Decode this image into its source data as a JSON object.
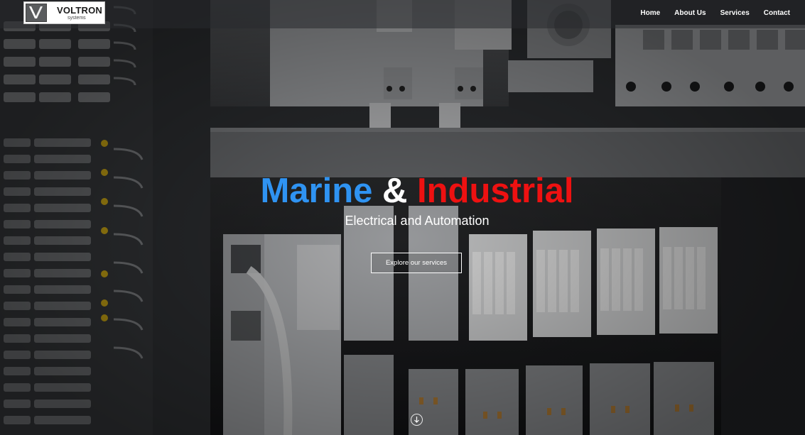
{
  "brand": {
    "name": "VOLTRON",
    "tagline": "systems"
  },
  "nav": {
    "items": [
      {
        "label": "Home"
      },
      {
        "label": "About Us"
      },
      {
        "label": "Services"
      },
      {
        "label": "Contact"
      }
    ]
  },
  "hero": {
    "title_part1": "Marine",
    "title_part2": "&",
    "title_part3": "Industrial",
    "subtitle": "Electrical and Automation",
    "cta_label": "Explore our services"
  },
  "colors": {
    "title_blue": "#2f93f2",
    "title_red": "#ee1111",
    "text_white": "#ffffff"
  },
  "icons": {
    "logo_mark": "v-logo-icon",
    "scroll": "arrow-down-icon"
  }
}
